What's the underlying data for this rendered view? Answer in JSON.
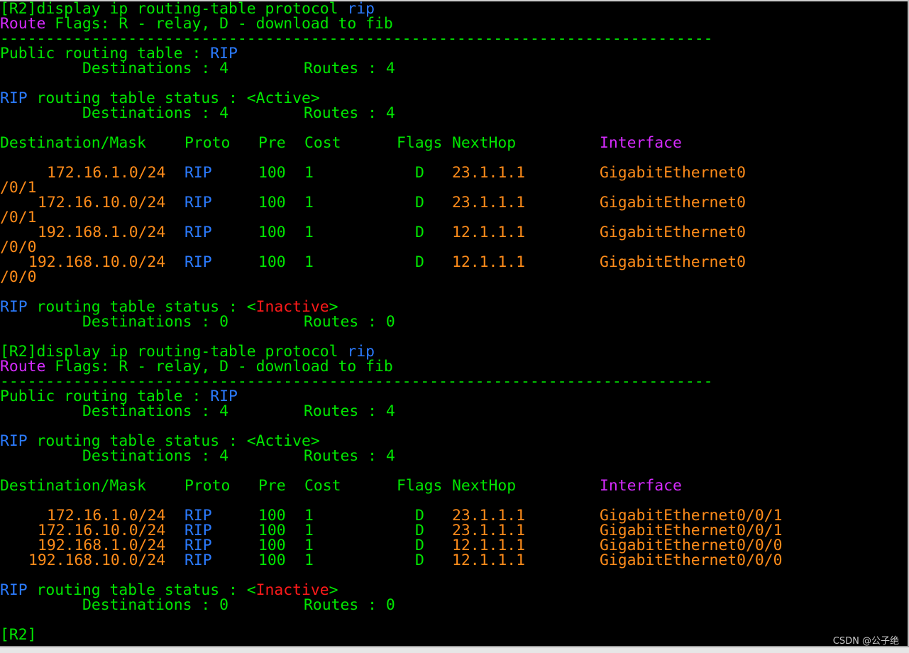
{
  "block1": {
    "cmd_prompt": "[R2]display ip routing-table protocol ",
    "cmd_arg": "rip",
    "flags_word": "Route",
    "flags_rest": " Flags: R - relay, D - download to fib",
    "separator": "------------------------------------------------------------------------------",
    "public_label": "Public routing table : ",
    "public_proto": "RIP",
    "dest_label": "Destinations : 4",
    "routes_label": "Routes : 4",
    "active_prefix": "RIP",
    "active_text": " routing table status : <Active>",
    "active_dest": "Destinations : 4",
    "active_routes": "Routes : 4",
    "hdr_dest": "Destination/Mask",
    "hdr_proto": "Proto",
    "hdr_pre": "Pre",
    "hdr_cost": "Cost",
    "hdr_flags": "Flags",
    "hdr_nexthop": "NextHop",
    "hdr_interface": "Interface",
    "rows": [
      {
        "dest": "172.16.1.0/24",
        "proto": "RIP",
        "pre": "100",
        "cost": "1",
        "flags": "D",
        "nexthop": "23.1.1.1",
        "iface": "GigabitEthernet0",
        "wrap": "/0/1"
      },
      {
        "dest": "172.16.10.0/24",
        "proto": "RIP",
        "pre": "100",
        "cost": "1",
        "flags": "D",
        "nexthop": "23.1.1.1",
        "iface": "GigabitEthernet0",
        "wrap": "/0/1"
      },
      {
        "dest": "192.168.1.0/24",
        "proto": "RIP",
        "pre": "100",
        "cost": "1",
        "flags": "D",
        "nexthop": "12.1.1.1",
        "iface": "GigabitEthernet0",
        "wrap": "/0/0"
      },
      {
        "dest": "192.168.10.0/24",
        "proto": "RIP",
        "pre": "100",
        "cost": "1",
        "flags": "D",
        "nexthop": "12.1.1.1",
        "iface": "GigabitEthernet0",
        "wrap": "/0/0"
      }
    ],
    "inactive_prefix": "RIP",
    "inactive_before": " routing table status : <",
    "inactive_word": "Inactive",
    "inactive_after": ">",
    "inactive_dest": "Destinations : 0",
    "inactive_routes": "Routes : 0"
  },
  "block2": {
    "cmd_prompt": "[R2]display ip routing-table protocol ",
    "cmd_arg": "rip",
    "flags_word": "Route",
    "flags_rest": " Flags: R - relay, D - download to fib",
    "separator": "------------------------------------------------------------------------------",
    "public_label": "Public routing table : ",
    "public_proto": "RIP",
    "dest_label": "Destinations : 4",
    "routes_label": "Routes : 4",
    "active_prefix": "RIP",
    "active_text": " routing table status : <Active>",
    "active_dest": "Destinations : 4",
    "active_routes": "Routes : 4",
    "hdr_dest": "Destination/Mask",
    "hdr_proto": "Proto",
    "hdr_pre": "Pre",
    "hdr_cost": "Cost",
    "hdr_flags": "Flags",
    "hdr_nexthop": "NextHop",
    "hdr_interface": "Interface",
    "rows": [
      {
        "dest": "172.16.1.0/24",
        "proto": "RIP",
        "pre": "100",
        "cost": "1",
        "flags": "D",
        "nexthop": "23.1.1.1",
        "iface": "GigabitEthernet0/0/1"
      },
      {
        "dest": "172.16.10.0/24",
        "proto": "RIP",
        "pre": "100",
        "cost": "1",
        "flags": "D",
        "nexthop": "23.1.1.1",
        "iface": "GigabitEthernet0/0/1"
      },
      {
        "dest": "192.168.1.0/24",
        "proto": "RIP",
        "pre": "100",
        "cost": "1",
        "flags": "D",
        "nexthop": "12.1.1.1",
        "iface": "GigabitEthernet0/0/0"
      },
      {
        "dest": "192.168.10.0/24",
        "proto": "RIP",
        "pre": "100",
        "cost": "1",
        "flags": "D",
        "nexthop": "12.1.1.1",
        "iface": "GigabitEthernet0/0/0"
      }
    ],
    "inactive_prefix": "RIP",
    "inactive_before": " routing table status : <",
    "inactive_word": "Inactive",
    "inactive_after": ">",
    "inactive_dest": "Destinations : 0",
    "inactive_routes": "Routes : 0"
  },
  "final_prompt": "[R2]",
  "watermark": "CSDN @公子绝",
  "colors": {
    "background": "#000000",
    "green": "#00e600",
    "blue": "#2b7bff",
    "magenta": "#d62bff",
    "orange": "#ff8c1a",
    "red": "#ff1a1a"
  }
}
